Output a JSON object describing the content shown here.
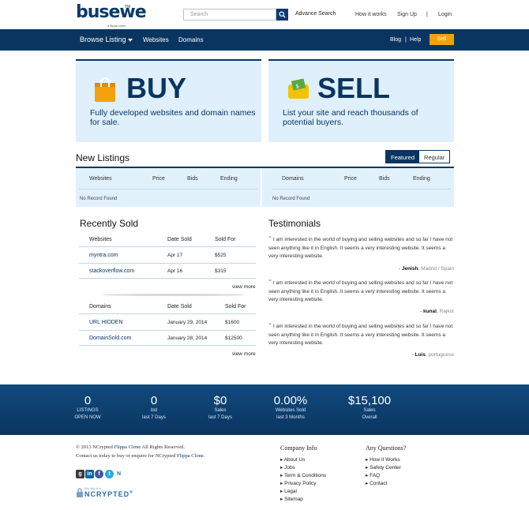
{
  "brand": {
    "logo": "busewe",
    "tm": "TM",
    "tagline": "a flippa clone"
  },
  "search": {
    "placeholder": "Search",
    "advance_label": "Advance Search"
  },
  "top_links": {
    "how_it_works": "How it works",
    "sign_up": "Sign Up",
    "separator": "|",
    "login": "Login"
  },
  "nav": {
    "browse": "Browse Listing",
    "websites": "Websites",
    "domains": "Domains",
    "blog": "Blog",
    "sep": "|",
    "help": "Help",
    "sell": "Sell"
  },
  "hero": {
    "buy": {
      "title": "BUY",
      "desc": "Fully developed websites and domain names for sale."
    },
    "sell": {
      "title": "SELL",
      "desc": "List your site and reach thousands of potential buyers."
    }
  },
  "new_listings": {
    "title": "New Listings",
    "tabs": [
      "Featured",
      "Regular"
    ],
    "left": {
      "headers": [
        "Websites",
        "Price",
        "Bids",
        "Ending"
      ],
      "empty": "No Record Found"
    },
    "right": {
      "headers": [
        "Domains",
        "Price",
        "Bids",
        "Ending"
      ],
      "empty": "No Record Found"
    }
  },
  "recently_sold": {
    "title": "Recently Sold",
    "websites": {
      "headers": [
        "Websites",
        "Date Sold",
        "Sold For"
      ],
      "rows": [
        {
          "name": "myntra.com",
          "date": "Apr 17",
          "price": "$525"
        },
        {
          "name": "stackoverflow.com",
          "date": "Apr 16",
          "price": "$315"
        }
      ],
      "more": "view more"
    },
    "domains": {
      "headers": [
        "Domains",
        "Date Sold",
        "Sold For"
      ],
      "rows": [
        {
          "name": "URL HIDDEN",
          "date": "January 29, 2014",
          "price": "$1600"
        },
        {
          "name": "DomainSold.com",
          "date": "January 28, 2014",
          "price": "$12500"
        }
      ],
      "more": "view more"
    }
  },
  "testimonials": {
    "title": "Testimonials",
    "items": [
      {
        "quote": "I am interested in the world of buying and selling websites and so far I have not seen anything like it in English. It seems a very interesting website. It seems a very interesting website.",
        "author": "Jenish",
        "location": "Madrid / Spain"
      },
      {
        "quote": "I am interested in the world of buying and selling websites and so far I have not seen anything like it in English. It seems a very interesting website. It seems a very interesting website.",
        "author": "kunal",
        "location": "Rajkot"
      },
      {
        "quote": "I am interested in the world of buying and selling websites and so far I have not seen anything like it in English. It seems a very interesting website. It seems a very interesting website.",
        "author": "Luis",
        "location": "portuguese"
      }
    ]
  },
  "stats": [
    {
      "value": "0",
      "l1": "LISTINGS",
      "l2": "OPEN NOW"
    },
    {
      "value": "0",
      "l1": "bid",
      "l2": "last 7 Days"
    },
    {
      "value": "$0",
      "l1": "Sales",
      "l2": "last 7 Days"
    },
    {
      "value": "0.00%",
      "l1": "Websites Sold",
      "l2": "last 3 Months"
    },
    {
      "value": "$15,100",
      "l1": "Sales",
      "l2": "Overall"
    }
  ],
  "footer": {
    "copyright_pre": "© 2013 NCrypted",
    "copyright_link": "Flippa Clone",
    "copyright_post": "All Rights Reserved.",
    "contact_pre": "Contact us today to buy or enquire for NCrypted",
    "contact_link": "Flippa Clone",
    "contact_post": ".",
    "company_head": "Company Info",
    "company_links": [
      "About Us",
      "Jobs",
      "Term & Conditions",
      "Privacy Policy",
      "Legal",
      "Sitemap"
    ],
    "questions_head": "Any Questions?",
    "questions_links": [
      "How It Works",
      "Safety Center",
      "FAQ",
      "Contact"
    ],
    "badge_sub": "this site is a",
    "badge_main": "NCRYPTED",
    "badge_reg": "®"
  },
  "colors": {
    "navy": "#0a3560",
    "accent": "#f5a00d",
    "hero_bg": "#dff0fc"
  }
}
